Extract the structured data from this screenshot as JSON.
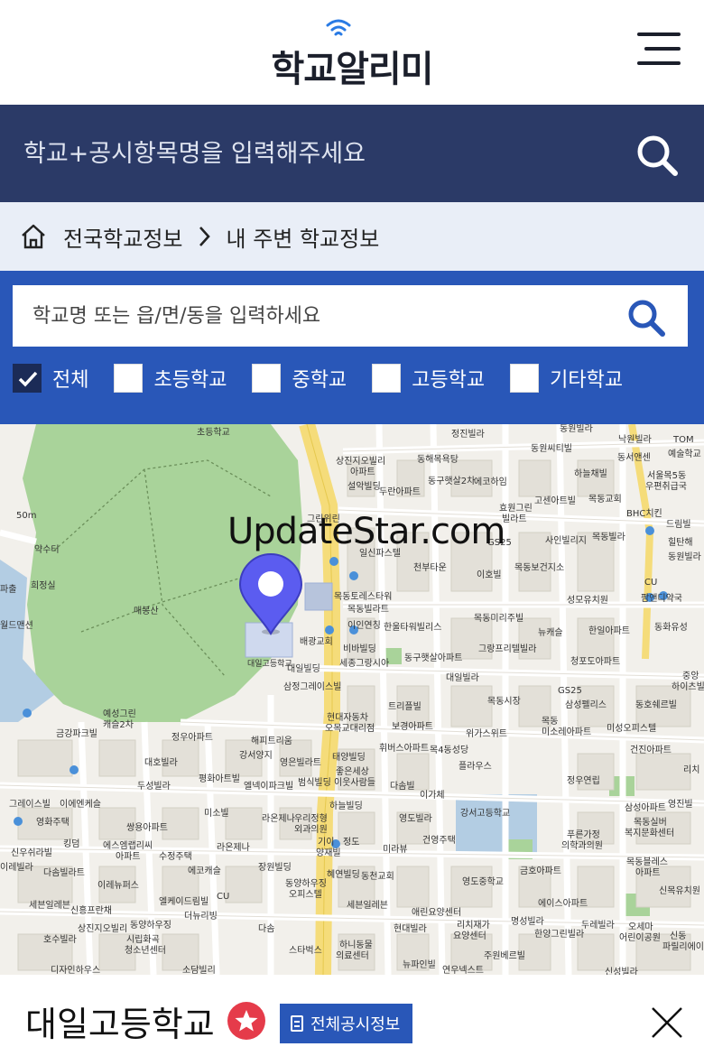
{
  "header": {
    "logo": "학교알리미",
    "menu_icon": "hamburger-menu-icon"
  },
  "global_search": {
    "placeholder": "학교+공시항목명을 입력해주세요",
    "icon": "search-icon"
  },
  "breadcrumb": {
    "home_icon": "home-icon",
    "items": [
      "전국학교정보",
      "내 주변 학교정보"
    ]
  },
  "school_search": {
    "placeholder": "학교명 또는 읍/면/동을 입력하세요",
    "icon": "search-icon"
  },
  "filters": [
    {
      "label": "전체",
      "checked": true
    },
    {
      "label": "초등학교",
      "checked": false
    },
    {
      "label": "중학교",
      "checked": false
    },
    {
      "label": "고등학교",
      "checked": false
    },
    {
      "label": "기타학교",
      "checked": false
    }
  ],
  "map": {
    "watermark": "UpdateStar.com",
    "selected_marker": "대일고등학교",
    "labels": {
      "l0": "초등학교",
      "l1": "정진빌라",
      "l2": "동원빌라",
      "l3": "낙원빌라",
      "l4": "동해목욕탕",
      "l5": "상진지오빌리",
      "l6": "아파트",
      "l7": "동원씨티빌",
      "l8": "동서앤센",
      "l9": "TOM",
      "l10": "예술학교",
      "l11": "설악빌딩",
      "l12": "에코하임",
      "l13": "동구햇살2차",
      "l14": "두란아파트",
      "l15": "하늘채빌",
      "l16": "서울목5동",
      "l17": "우편취급국",
      "l18": "목동교회",
      "l19": "고센아트빌",
      "l20": "효원그린",
      "l21": "빌라트",
      "l22": "BHC치킨",
      "l23": "드림빌",
      "l24": "그린위린",
      "l25": "일신파스텔",
      "l26": "GS25",
      "l27": "사인빌리지",
      "l28": "목동빌라",
      "l29": "힐탄해",
      "l30": "약수터",
      "l31": "천부타운",
      "l32": "이호빌",
      "l33": "목동보건지소",
      "l34": "동원빌라",
      "l35": "희정실",
      "l36": "목동토레스타워",
      "l37": "성모유치원",
      "l38": "파출",
      "l39": "CU",
      "l40": "팜앤디약국",
      "l41": "매봉산",
      "l42": "목동빌라트",
      "l43": "이인연칭",
      "l44": "한울타워빌리스",
      "l45": "목동미리주빌",
      "l46": "뉴캐슬",
      "l47": "한일아파트",
      "l48": "동화유성",
      "l49": "월드맨션",
      "l50": "배광교회",
      "l51": "비바빌딩",
      "l52": "그랑프리텔빌라",
      "l53": "청포도아파트",
      "l54": "대일고등학교",
      "l55": "대일빌딩",
      "l56": "세종그랑시아",
      "l57": "동구햇살아파트",
      "l58": "삼정그레이스빌",
      "l59": "대일빌라",
      "l60": "중앙",
      "l61": "하이츠빌",
      "l62": "목동시장",
      "l63": "GS25",
      "l64": "삼성펠리스",
      "l65": "동호쉐르빌",
      "l66": "예성그린",
      "l67": "캐슬2차",
      "l68": "트리플빌",
      "l69": "현대자동차",
      "l70": "오목교대리점",
      "l71": "보경아파트",
      "l72": "위가스위트",
      "l73": "목동",
      "l74": "미소레아파트",
      "l75": "미성오피스텔",
      "l76": "금강파크빌",
      "l77": "정우아파트",
      "l78": "해피트리움",
      "l79": "대호빌라",
      "l80": "강서양지",
      "l81": "영은빌라트",
      "l82": "태양빌딩",
      "l83": "휘버스아파트",
      "l84": "목4동성당",
      "l85": "건진아파트",
      "l86": "평화아트빌",
      "l87": "좋은세상",
      "l88": "이웃사람들",
      "l89": "플라우스",
      "l90": "엘넥이파크빌",
      "l91": "범식빌딩",
      "l92": "다솜빌",
      "l93": "정우연립",
      "l94": "리치",
      "l95": "두성빌라",
      "l96": "하늘빌딩",
      "l97": "이가체",
      "l98": "삼성아파트",
      "l99": "영진빌",
      "l100": "그레이스빌",
      "l101": "이에엔케슬",
      "l102": "라온제나",
      "l103": "우리정형",
      "l104": "영도빌라",
      "l105": "강서고등학교",
      "l106": "미소빌",
      "l107": "외과의원",
      "l108": "목동실버",
      "l109": "복지문화센터",
      "l110": "영화주택",
      "l111": "쌍용아파트",
      "l112": "라온제나",
      "l113": "기이",
      "l114": "정도",
      "l115": "건영주택",
      "l116": "푸른가정",
      "l117": "의학과의원",
      "l118": "킹덤",
      "l119": "에스엠랩리씨",
      "l120": "미라뷰",
      "l121": "신우쉬라빌",
      "l122": "아파트",
      "l123": "수정주택",
      "l124": "양재빌",
      "l125": "목동블레스",
      "l126": "아파트",
      "l127": "다솜빌라트",
      "l128": "이레빌라",
      "l129": "에코캐슬",
      "l130": "장원빌딩",
      "l131": "혜연빌딩",
      "l132": "동천교회",
      "l133": "영도중학교",
      "l134": "금호아파트",
      "l135": "신목유치원",
      "l136": "이레뉴퍼스",
      "l137": "동양하우징",
      "l138": "오피스텔",
      "l139": "세븐일레븐",
      "l140": "신흥프란채",
      "l141": "엘케이드림빌",
      "l142": "CU",
      "l143": "세븐일레븐",
      "l144": "애린요양센터",
      "l145": "에이스아파트",
      "l146": "상진지오빌리",
      "l147": "동양하우징",
      "l148": "다솜",
      "l149": "리치재가",
      "l150": "요양센터",
      "l151": "명성빌라",
      "l152": "두레빌라",
      "l153": "신동",
      "l154": "호수빌라",
      "l155": "시립화곡",
      "l156": "청소년센터",
      "l157": "스타벅스",
      "l158": "하니동물",
      "l159": "의료센터",
      "l160": "현대빌라",
      "l161": "한양그린빌라",
      "l162": "주원베르빌",
      "l163": "어린이공원",
      "l164": "파릴리에이시",
      "l165": "디자인하우스",
      "l166": "소담빌리",
      "l167": "뉴파인빌",
      "l168": "연우넥스트",
      "l169": "신성빌라",
      "l170": "50m",
      "l171": "오세마",
      "l172": "더뉴리빙"
    }
  },
  "bottom_bar": {
    "school_name": "대일고등학교",
    "fav_icon": "star-icon",
    "info_button": "전체공시정보",
    "close_icon": "close-icon"
  },
  "colors": {
    "header_navy": "#2b3a67",
    "filter_blue": "#2957b8",
    "breadcrumb_bg": "#e9eef7",
    "marker_purple": "#5b5cf0",
    "favorite_red": "#e53b4a"
  }
}
